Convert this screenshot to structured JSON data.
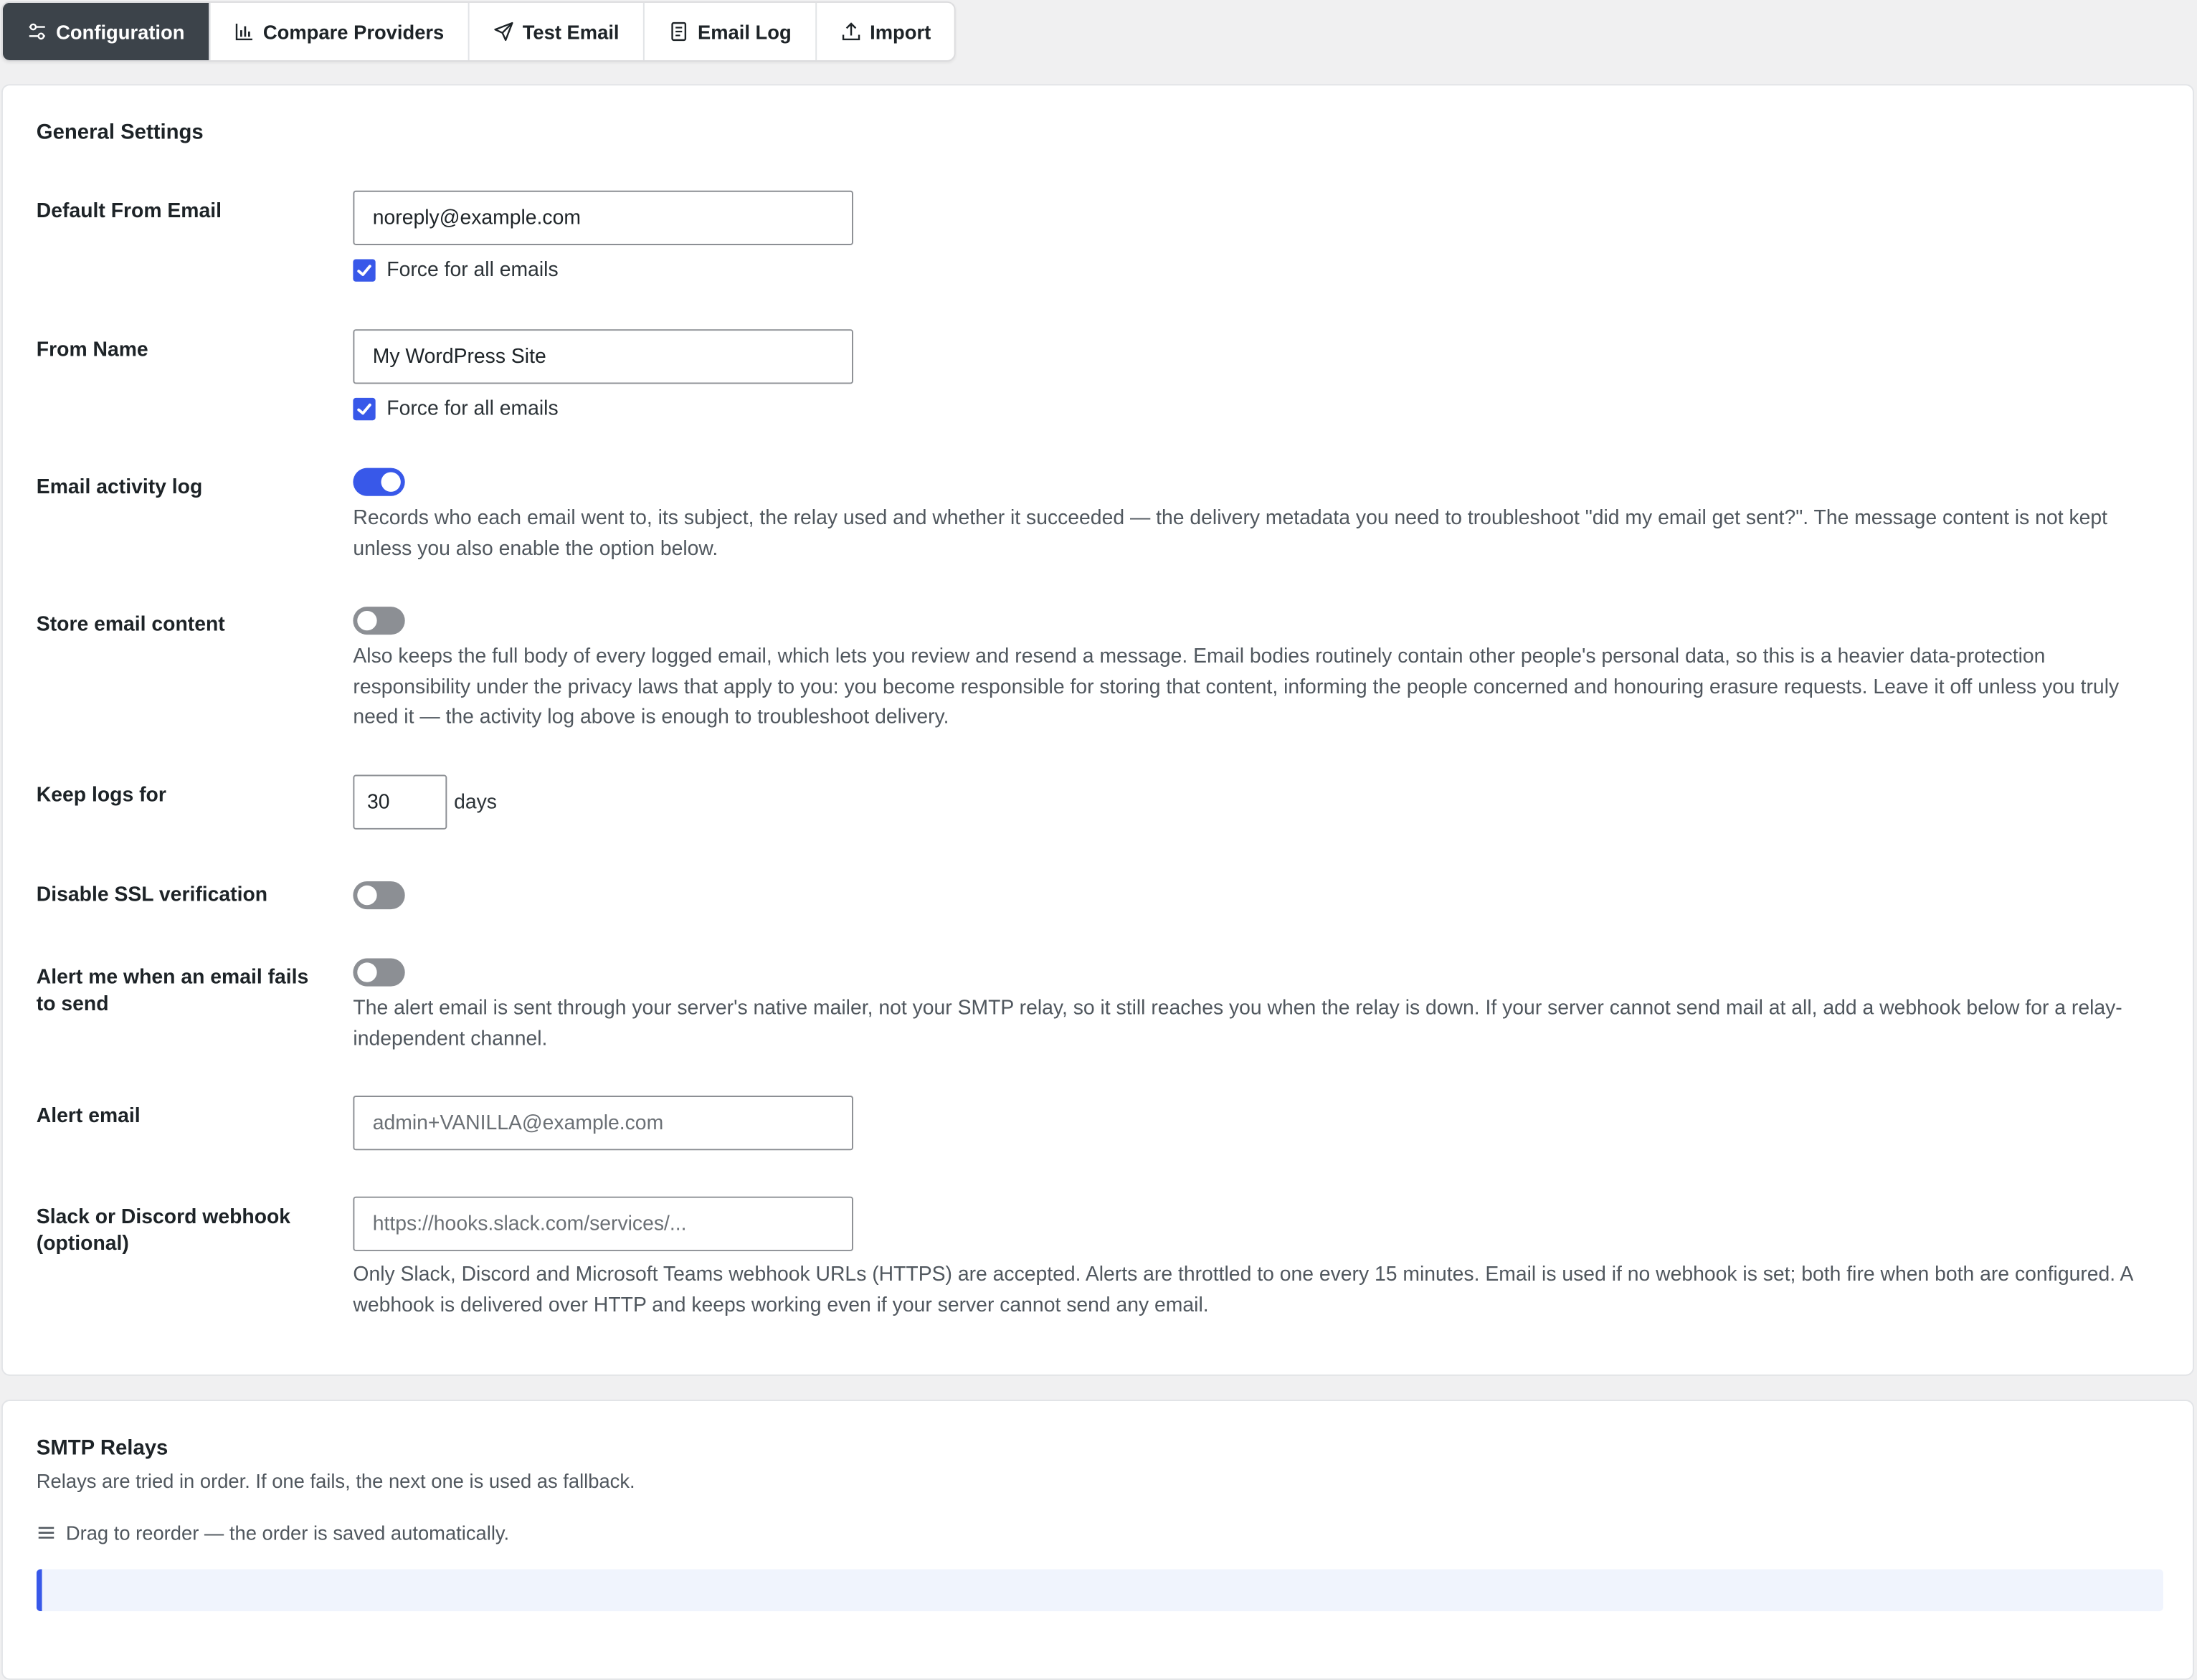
{
  "tabs": [
    {
      "label": "Configuration",
      "icon": "sliders-icon",
      "active": true
    },
    {
      "label": "Compare Providers",
      "icon": "bar-chart-icon",
      "active": false
    },
    {
      "label": "Test Email",
      "icon": "paper-plane-icon",
      "active": false
    },
    {
      "label": "Email Log",
      "icon": "receipt-icon",
      "active": false
    },
    {
      "label": "Import",
      "icon": "upload-icon",
      "active": false
    }
  ],
  "general": {
    "title": "General Settings",
    "from_email": {
      "label": "Default From Email",
      "value": "noreply@example.com",
      "force_label": "Force for all emails",
      "force_checked": true
    },
    "from_name": {
      "label": "From Name",
      "value": "My WordPress Site",
      "force_label": "Force for all emails",
      "force_checked": true
    },
    "activity_log": {
      "label": "Email activity log",
      "enabled": true,
      "help": "Records who each email went to, its subject, the relay used and whether it succeeded — the delivery metadata you need to troubleshoot \"did my email get sent?\". The message content is not kept unless you also enable the option below."
    },
    "store_content": {
      "label": "Store email content",
      "enabled": false,
      "help": "Also keeps the full body of every logged email, which lets you review and resend a message. Email bodies routinely contain other people's personal data, so this is a heavier data-protection responsibility under the privacy laws that apply to you: you become responsible for storing that content, informing the people concerned and honouring erasure requests. Leave it off unless you truly need it — the activity log above is enough to troubleshoot delivery."
    },
    "keep_logs": {
      "label": "Keep logs for",
      "value": "30",
      "unit": "days"
    },
    "disable_ssl": {
      "label": "Disable SSL verification",
      "enabled": false
    },
    "alert_fail": {
      "label": "Alert me when an email fails to send",
      "enabled": false,
      "help": "The alert email is sent through your server's native mailer, not your SMTP relay, so it still reaches you when the relay is down. If your server cannot send mail at all, add a webhook below for a relay-independent channel."
    },
    "alert_email": {
      "label": "Alert email",
      "placeholder": "admin+VANILLA@example.com"
    },
    "webhook": {
      "label": "Slack or Discord webhook (optional)",
      "placeholder": "https://hooks.slack.com/services/...",
      "help": "Only Slack, Discord and Microsoft Teams webhook URLs (HTTPS) are accepted. Alerts are throttled to one every 15 minutes. Email is used if no webhook is set; both fire when both are configured. A webhook is delivered over HTTP and keeps working even if your server cannot send any email."
    }
  },
  "smtp": {
    "title": "SMTP Relays",
    "description": "Relays are tried in order. If one fails, the next one is used as fallback.",
    "drag_hint": "Drag to reorder — the order is saved automatically."
  },
  "colors": {
    "accent": "#3858e9",
    "active_tab": "#3c434a",
    "toggle_off": "#8c8f94"
  }
}
